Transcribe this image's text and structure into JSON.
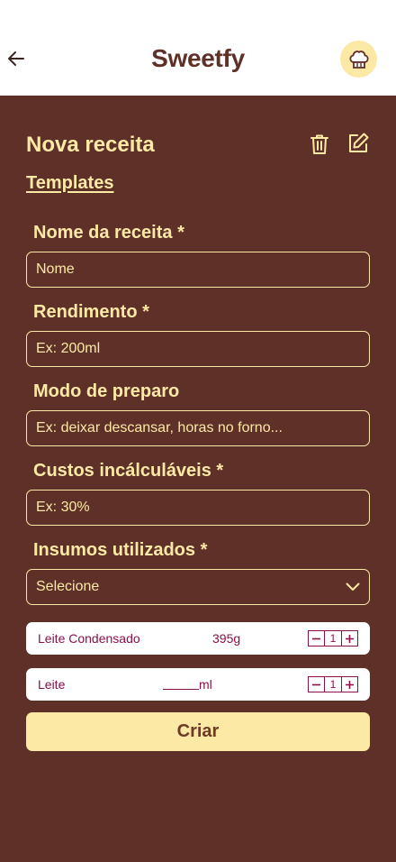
{
  "header": {
    "title": "Sweetfy",
    "back_icon": "arrow-left-icon",
    "avatar_icon": "chef-hat-icon"
  },
  "page": {
    "title": "Nova receita",
    "templates_label": "Templates",
    "delete_icon": "trash-icon",
    "edit_icon": "edit-icon"
  },
  "form": {
    "name": {
      "label": "Nome da receita *",
      "placeholder": "Nome"
    },
    "yield": {
      "label": "Rendimento *",
      "placeholder": "Ex: 200ml"
    },
    "method": {
      "label": "Modo de preparo",
      "placeholder": "Ex: deixar descansar, horas no forno..."
    },
    "costs": {
      "label": "Custos incálculáveis *",
      "placeholder": "Ex: 30%"
    },
    "supplies": {
      "label": "Insumos utilizados *",
      "selected": "Selecione"
    }
  },
  "ingredients": [
    {
      "name": "Leite Condensado",
      "quantity": "395g",
      "count": "1"
    },
    {
      "name": "Leite",
      "unit": "ml",
      "count": "1"
    }
  ],
  "submit_label": "Criar",
  "colors": {
    "background": "#5e3027",
    "accent": "#fde9a6",
    "ingredient_text": "#8b0f4b",
    "header_bg": "#ffffff"
  }
}
